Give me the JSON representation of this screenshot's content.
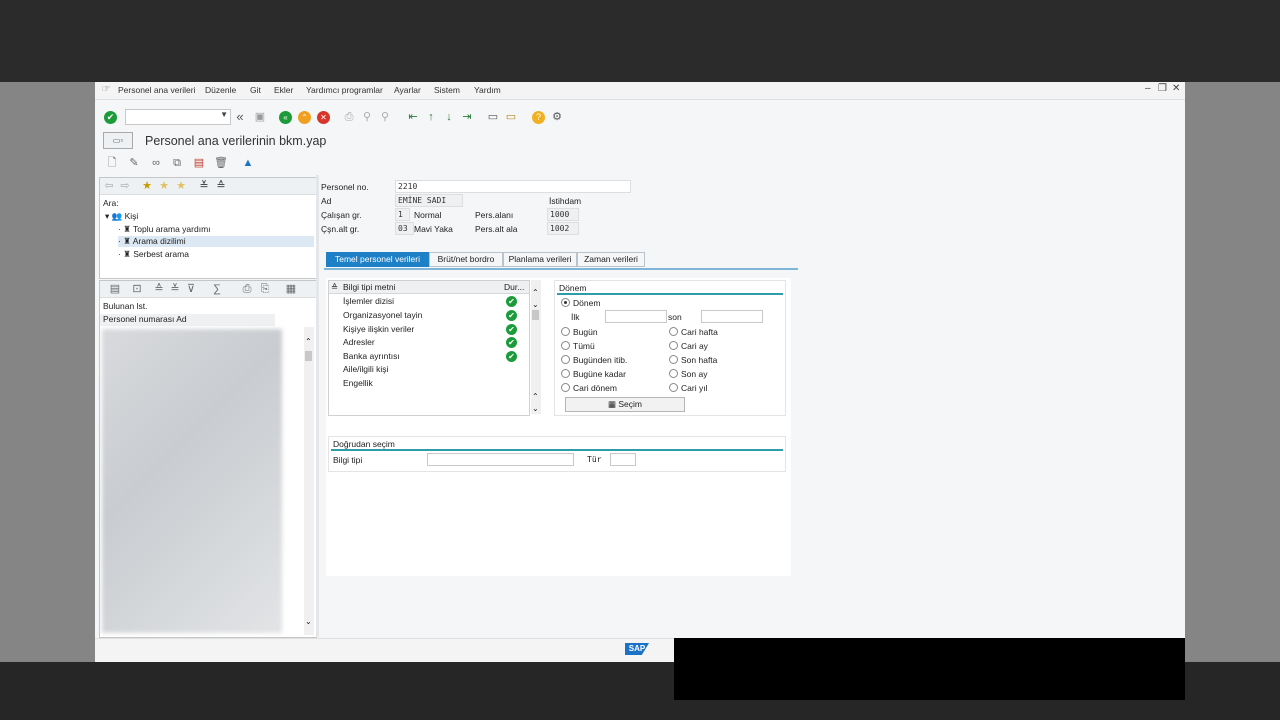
{
  "menu": {
    "items": [
      "Personel ana verileri",
      "Düzenle",
      "Git",
      "Ekler",
      "Yardımcı programlar",
      "Ayarlar",
      "Sistem",
      "Yardım"
    ]
  },
  "window_controls": {
    "minimize": "–",
    "restore": "❐",
    "close": "✕"
  },
  "page": {
    "title": "Personel ana verilerinin bkm.yap"
  },
  "left_pane": {
    "search_label": "Ara:",
    "tree": [
      {
        "label": "Kişi"
      },
      {
        "label": "Toplu arama yardımı"
      },
      {
        "label": "Arama dizilimi"
      },
      {
        "label": "Serbest arama"
      }
    ],
    "found_label": "Bulunan lst.",
    "column_header": "Personel numarası Ad"
  },
  "header_fields": {
    "personel_no_label": "Personel no.",
    "personel_no_value": "2210",
    "ad_label": "Ad",
    "ad_value": "EMİNE SADI",
    "istihdam_label": "İstihdam",
    "calisan_gr_label": "Çalışan gr.",
    "calisan_gr_code": "1",
    "calisan_gr_text": "Normal",
    "pers_alani_label": "Pers.alanı",
    "pers_alani_value": "1000",
    "csn_alt_gr_label": "Çşn.alt gr.",
    "csn_alt_gr_code": "03",
    "csn_alt_gr_text": "Mavi Yaka",
    "pers_alt_ala_label": "Pers.alt ala",
    "pers_alt_ala_value": "1002"
  },
  "tabs": [
    {
      "label": "Temel personel verileri",
      "active": true
    },
    {
      "label": "Brüt/net bordro",
      "active": false
    },
    {
      "label": "Planlama verileri",
      "active": false
    },
    {
      "label": "Zaman verileri",
      "active": false
    }
  ],
  "infotype_list": {
    "col_text": "Bilgi tipi metni",
    "col_status": "Dur...",
    "rows": [
      {
        "label": "İşlemler dizisi",
        "status": true
      },
      {
        "label": "Organizasyonel tayin",
        "status": true
      },
      {
        "label": "Kişiye ilişkin veriler",
        "status": true
      },
      {
        "label": "Adresler",
        "status": true
      },
      {
        "label": "Banka ayrıntısı",
        "status": true
      },
      {
        "label": "Aile/ilgili kişi",
        "status": false
      },
      {
        "label": "Engellik",
        "status": false
      }
    ]
  },
  "donem": {
    "title": "Dönem",
    "donem_radio": "Dönem",
    "ilk_label": "İlk",
    "son_label": "son",
    "radios_left": [
      "Bugün",
      "Tümü",
      "Bugünden itib.",
      "Bugüne kadar",
      "Cari dönem"
    ],
    "radios_right": [
      "Cari hafta",
      "Cari ay",
      "Son hafta",
      "Son ay",
      "Cari yıl"
    ],
    "secim_button": "Seçim"
  },
  "direct": {
    "title": "Doğrudan seçim",
    "bilgi_tipi_label": "Bilgi tipi",
    "tur_label": "Tür"
  },
  "colors": {
    "accent": "#1e80c6",
    "group_line": "#2e9ca9",
    "check": "#1b9b3a"
  }
}
